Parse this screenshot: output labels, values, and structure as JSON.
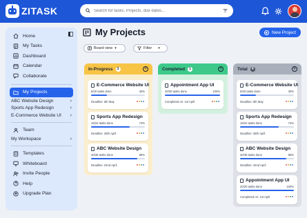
{
  "brand": {
    "name": "ZITASK"
  },
  "search": {
    "placeholder": "Search for tasks, Projects, due dates..."
  },
  "sidebar": {
    "top_items": [
      {
        "label": "Home",
        "icon": "home-icon"
      },
      {
        "label": "My Tasks",
        "icon": "tasks-icon"
      },
      {
        "label": "Dashboard",
        "icon": "dashboard-icon"
      },
      {
        "label": "Calendar",
        "icon": "calendar-icon"
      },
      {
        "label": "Collaborate",
        "icon": "collaborate-icon"
      }
    ],
    "my_projects": "My Projects",
    "projects": [
      "ABC Website Design",
      "Sports App Redesign",
      "E-Commerce Website UI"
    ],
    "team": "Team",
    "workspace": "My Workspace",
    "bottom_items": [
      {
        "label": "Templates",
        "icon": "templates-icon"
      },
      {
        "label": "Whiteboard",
        "icon": "whiteboard-icon"
      },
      {
        "label": "Invite People",
        "icon": "invite-icon"
      },
      {
        "label": "Help",
        "icon": "help-icon"
      },
      {
        "label": "Upgrade Plan",
        "icon": "upgrade-icon"
      }
    ]
  },
  "main": {
    "title": "My Projects",
    "new_project": "New Project",
    "board_view": "Board view",
    "filter": "Filter"
  },
  "columns": [
    {
      "name": "In-Progress",
      "count": "3",
      "color": "#f5b52e",
      "bg": "#fbeecd",
      "head_bg": "#f7c446",
      "cards": [
        {
          "title": "E-Commerce Website UI",
          "tasks": "6/20 tasks done",
          "percent": "30%",
          "progress": 0.3,
          "deadline": "Deadline: 5th May"
        },
        {
          "title": "Sports App Redesign",
          "tasks": "16/22 tasks done",
          "percent": "72%",
          "progress": 0.72,
          "deadline": "Deadline: 28th April"
        },
        {
          "title": "ABC Website Design",
          "tasks": "40/46 tasks done",
          "percent": "86%",
          "progress": 0.86,
          "deadline": "Deadline: 22nd April"
        }
      ]
    },
    {
      "name": "Completed",
      "count": "1",
      "color": "#2bb673",
      "bg": "#d4f1e0",
      "head_bg": "#3ec98a",
      "cards": [
        {
          "title": "Appointment App UI",
          "tasks": "20/20 tasks done",
          "percent": "100%",
          "progress": 1.0,
          "deadline": "Completed on: 1st April"
        }
      ]
    },
    {
      "name": "Total",
      "count": "4",
      "color": "#6b7280",
      "bg": "#dde1e7",
      "head_bg": "#a9b0bb",
      "cards": [
        {
          "title": "E-Commerce Website UI",
          "tasks": "6/20 tasks done",
          "percent": "30%",
          "progress": 0.3,
          "deadline": "Deadline: 5th May"
        },
        {
          "title": "Sports App Redesign",
          "tasks": "16/22 tasks done",
          "percent": "72%",
          "progress": 0.72,
          "deadline": "Deadline: 28th April"
        },
        {
          "title": "ABC Website Design",
          "tasks": "40/46 tasks done",
          "percent": "86%",
          "progress": 0.86,
          "deadline": "Deadline: 22nd April"
        },
        {
          "title": "Appointment App UI",
          "tasks": "20/20 tasks done",
          "percent": "100%",
          "progress": 1.0,
          "deadline": "Completed on: 1st April"
        }
      ]
    }
  ],
  "colors": {
    "primary": "#1e56d8",
    "accent": "#2563eb"
  }
}
